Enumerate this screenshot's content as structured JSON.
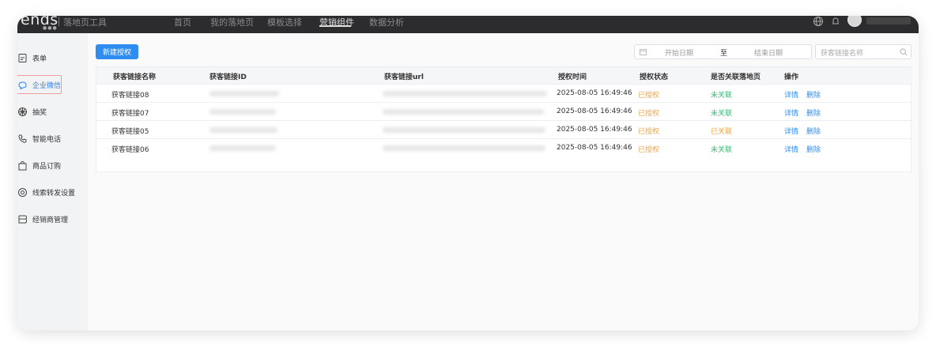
{
  "topbar": {
    "logo": "ends",
    "logo_sub": "●●●",
    "app_name": "落地页工具",
    "nav": [
      "首页",
      "我的落地页",
      "模板选择",
      "营销组件",
      "数据分析"
    ],
    "active_nav": "营销组件"
  },
  "sidebar": {
    "items": [
      {
        "label": "表单",
        "icon": "form-icon"
      },
      {
        "label": "企业微信",
        "icon": "wecom-icon"
      },
      {
        "label": "抽奖",
        "icon": "lottery-icon"
      },
      {
        "label": "智能电话",
        "icon": "phone-icon"
      },
      {
        "label": "商品订购",
        "icon": "shopping-bag-icon"
      },
      {
        "label": "线索转发设置",
        "icon": "settings-icon"
      },
      {
        "label": "经销商管理",
        "icon": "dealer-icon"
      }
    ],
    "active": "企业微信"
  },
  "toolbar": {
    "new_button": "新建授权",
    "date_start_placeholder": "开始日期",
    "date_separator": "至",
    "date_end_placeholder": "结束日期",
    "search_placeholder": "获客链接名称"
  },
  "table": {
    "columns": [
      "获客链接名称",
      "获客链接ID",
      "获客链接url",
      "授权时间",
      "授权状态",
      "是否关联落地页",
      "操作"
    ],
    "rows": [
      {
        "name": "获客链接08",
        "time": "2025-08-05 16:49:46",
        "status": "已授权",
        "linked": "未关联",
        "action_detail": "详情",
        "action_delete": "删除"
      },
      {
        "name": "获客链接07",
        "time": "2025-08-05 16:49:46",
        "status": "已授权",
        "linked": "未关联",
        "action_detail": "详情",
        "action_delete": "删除"
      },
      {
        "name": "获客链接05",
        "time": "2025-08-05 16:49:46",
        "status": "已授权",
        "linked": "已关联",
        "action_detail": "详情",
        "action_delete": "删除"
      },
      {
        "name": "获客链接06",
        "time": "2025-08-05 16:49:46",
        "status": "已授权",
        "linked": "未关联",
        "action_detail": "详情",
        "action_delete": "删除"
      }
    ]
  },
  "colors": {
    "primary": "#2f8cf0",
    "status_authorized": "#f0a64a",
    "linked_no": "#3cb878",
    "linked_yes": "#f0a64a"
  }
}
